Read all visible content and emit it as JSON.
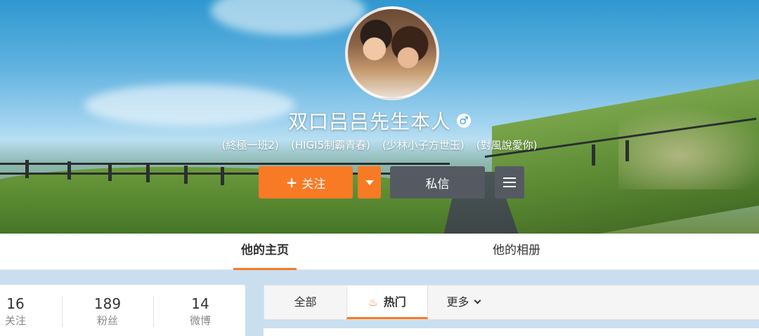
{
  "profile": {
    "name": "双口吕吕先生本人",
    "gender_icon": "male-icon",
    "gender_symbol": "♂",
    "tags": [
      "(終極一班2)",
      "(HIGI5制霸青春)",
      "(少林小子方世玉)",
      "(對風說愛你)"
    ]
  },
  "actions": {
    "follow_label": "关注",
    "follow_plus": "+",
    "message_label": "私信"
  },
  "tabs": {
    "home": "他的主页",
    "album": "他的相册"
  },
  "stats": [
    {
      "num": "16",
      "label": "关注"
    },
    {
      "num": "189",
      "label": "粉丝"
    },
    {
      "num": "14",
      "label": "微博"
    }
  ],
  "feed_filters": {
    "all": "全部",
    "hot": "热门",
    "more": "更多"
  },
  "colors": {
    "accent": "#f97a24",
    "dark_button": "#555a62",
    "page_bg": "#c9dff0"
  }
}
